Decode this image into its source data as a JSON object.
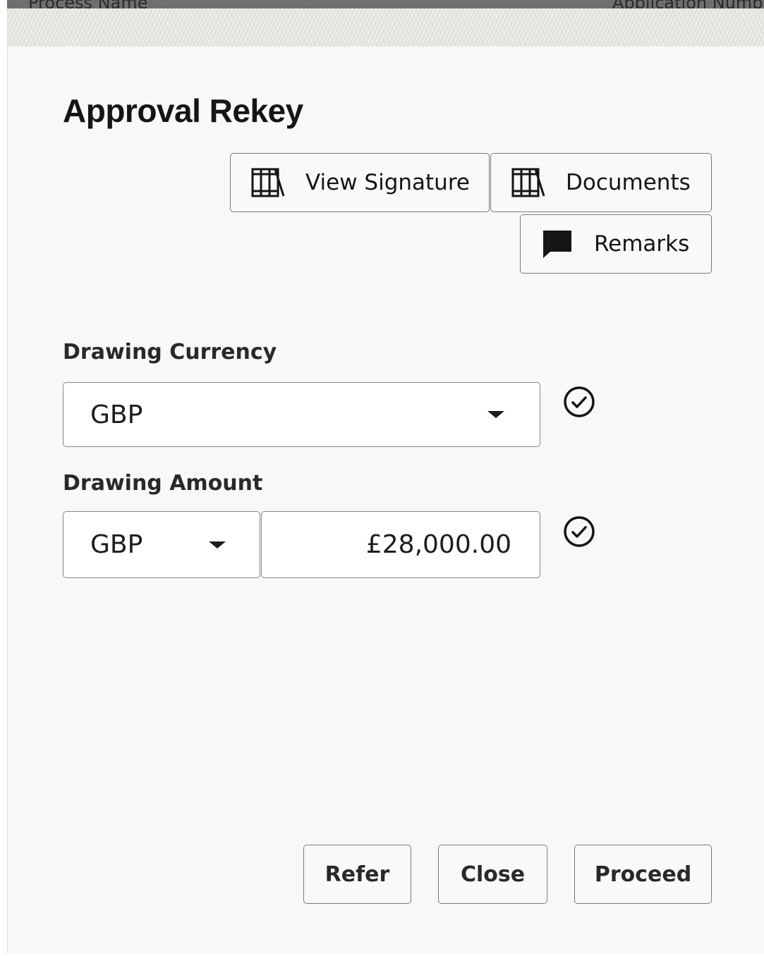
{
  "background": {
    "header_fragments": [
      "Process Name",
      "Application Number"
    ]
  },
  "dialog": {
    "title": "Approval Rekey",
    "actions": {
      "view_signature": {
        "label": "View Signature",
        "icon": "library-books-icon"
      },
      "documents": {
        "label": "Documents",
        "icon": "library-books-icon"
      },
      "remarks": {
        "label": "Remarks",
        "icon": "comment-icon"
      }
    },
    "fields": {
      "drawing_currency": {
        "label": "Drawing Currency",
        "value": "GBP",
        "validated": true
      },
      "drawing_amount": {
        "label": "Drawing Amount",
        "currency": "GBP",
        "value": "£28,000.00",
        "validated": true
      }
    },
    "footer": {
      "refer": "Refer",
      "close": "Close",
      "proceed": "Proceed"
    }
  },
  "colors": {
    "dialog_background": "#f9f8f6",
    "border": "#7d7a75",
    "text": "#161513"
  }
}
